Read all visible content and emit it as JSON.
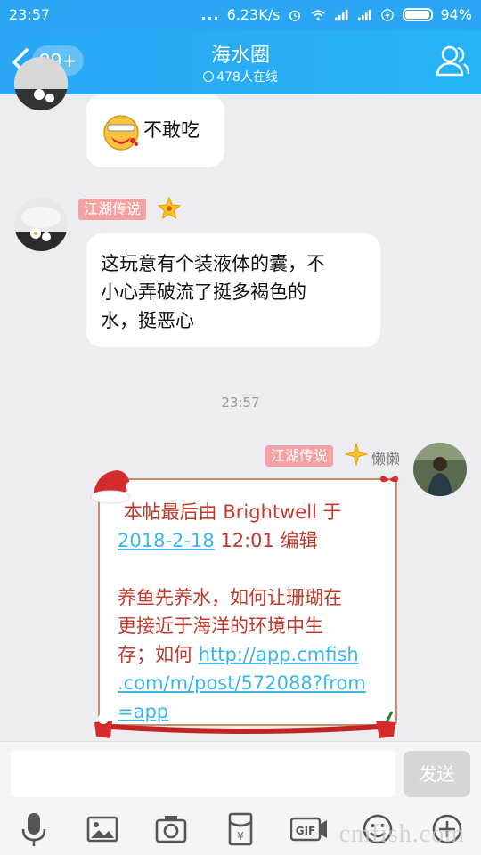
{
  "status_bar": {
    "time": "23:57",
    "dots": "...",
    "speed": "6.23K/s",
    "battery": "94%",
    "battery_level": 0.94
  },
  "header": {
    "back_icon": "chevron-left-icon",
    "unread_badge": "99+",
    "title": "海水圈",
    "online_text": "478人在线",
    "profile_icon": "group-members-icon"
  },
  "messages": [
    {
      "side": "left",
      "text": "不敢吃",
      "emoji": "sick-face-emoji"
    },
    {
      "side": "left",
      "tag": "江湖传说",
      "text_lines": [
        "这玩意有个装液体的囊，不",
        "小心弄破流了挺多褐色的",
        "水，挺恶心"
      ]
    }
  ],
  "timestamp": "23:57",
  "self_message": {
    "tag": "江湖传说",
    "nickname": "懒懒",
    "line1_prefix": "本帖最后由 Brightwell 于",
    "line2_link": "2018-2-18",
    "line2_rest": " 12:01 编辑",
    "body_lines": [
      "养鱼先养水，如何让珊瑚在",
      "更接近于海洋的环境中生",
      "存；如何 "
    ],
    "url_parts": [
      "http://app.cmfish",
      ".com/m/post/572088?from",
      "=app"
    ]
  },
  "input": {
    "placeholder": "",
    "value": "",
    "send_label": "发送"
  },
  "toolbar_icons": [
    "microphone-icon",
    "image-icon",
    "camera-icon",
    "red-packet-icon",
    "gif-icon",
    "emoji-icon",
    "plus-icon"
  ],
  "watermark": "cmfish.com",
  "colors": {
    "header_blue": "#2aa6f3",
    "tag_pink": "#f3a1a1",
    "card_text_red": "#c0392b",
    "link_blue": "#3ab7e8"
  }
}
